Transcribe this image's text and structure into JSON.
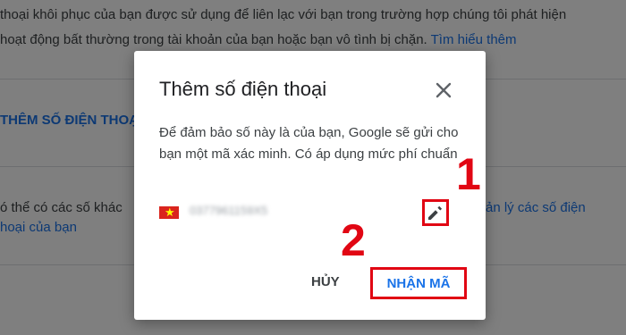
{
  "background": {
    "line1": "thoại khôi phục của bạn được sử dụng để liên lạc với bạn trong trường hợp chúng tôi phát hiện",
    "line2": "hoạt động bất thường trong tài khoản của bạn hoặc bạn vô tình bị chặn.",
    "learn_more": "Tìm hiểu thêm",
    "add_phone": "THÊM SỐ ĐIỆN THOẠI",
    "other_numbers_line1": "ó thể có các số khác",
    "manage_link_line1": "ản lý các số điện",
    "manage_link_line2": "hoại của bạn"
  },
  "dialog": {
    "title": "Thêm số điện thoại",
    "body": "Để đảm bảo số này là của bạn, Google sẽ gửi cho bạn một mã xác minh. Có áp dụng mức phí chuẩn",
    "phone_number": "0377961159X5",
    "cancel_label": "HỦY",
    "confirm_label": "NHẬN MÃ"
  },
  "annotations": {
    "step1": "1",
    "step2": "2"
  },
  "icons": {
    "close": "close-icon",
    "edit": "pencil-icon",
    "flag": "vietnam-flag-icon"
  },
  "colors": {
    "accent": "#1a73e8",
    "highlight": "#e10613",
    "overlay": "rgba(0,0,0,0.5)"
  }
}
